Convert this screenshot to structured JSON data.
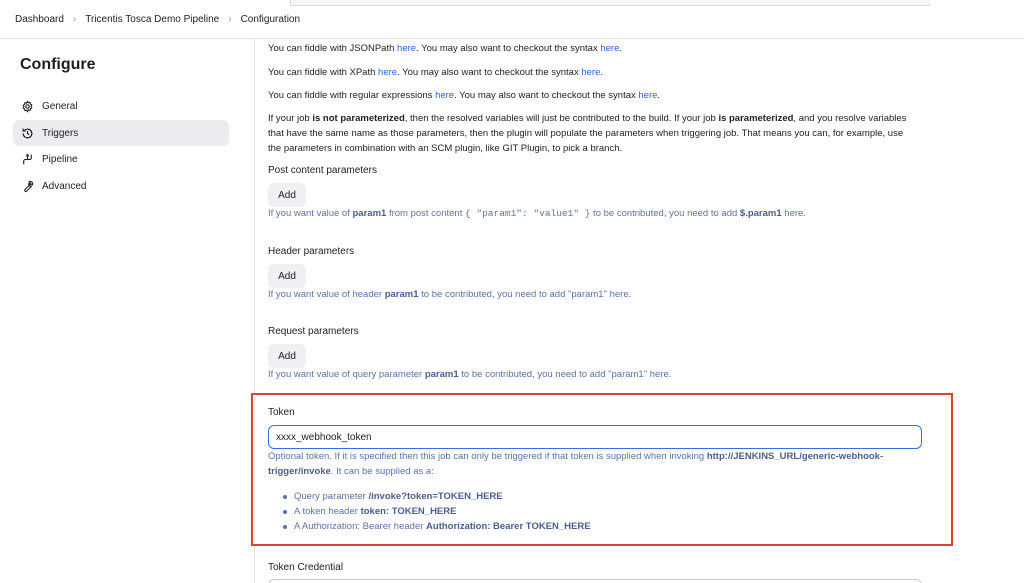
{
  "breadcrumb": [
    {
      "label": "Dashboard"
    },
    {
      "label": "Tricentis Tosca Demo Pipeline"
    },
    {
      "label": "Configuration"
    }
  ],
  "sidebar": {
    "title": "Configure",
    "items": [
      {
        "label": "General",
        "icon": "gear-icon",
        "active": false
      },
      {
        "label": "Triggers",
        "icon": "clock-icon",
        "active": true
      },
      {
        "label": "Pipeline",
        "icon": "pipeline-icon",
        "active": false
      },
      {
        "label": "Advanced",
        "icon": "wrench-icon",
        "active": false
      }
    ]
  },
  "main": {
    "jsonpath": {
      "pre": "You can fiddle with JSONPath ",
      "link1": "here",
      "mid": ". You may also want to checkout the syntax ",
      "link2": "here",
      "post": "."
    },
    "xpath": {
      "pre": "You can fiddle with XPath ",
      "link1": "here",
      "mid": ". You may also want to checkout the syntax ",
      "link2": "here",
      "post": "."
    },
    "regex": {
      "pre": "You can fiddle with regular expressions ",
      "link1": "here",
      "mid": ". You may also want to checkout the syntax ",
      "link2": "here",
      "post": "."
    },
    "param_note": {
      "t1": "If your job ",
      "b1": "is not parameterized",
      "t2": ", then the resolved variables will just be contributed to the build. If your job ",
      "b2": "is parameterized",
      "t3": ", and you resolve variables that have the same name as those parameters, then the plugin will populate the parameters when triggering job. That means you can, for example, use the parameters in combination with an SCM plugin, like GIT Plugin, to pick a branch."
    },
    "post_content": {
      "label": "Post content parameters",
      "button": "Add",
      "help": {
        "t1": "If you want value of ",
        "b1": "param1",
        "t2": " from post content ",
        "code": "{ \"param1\": \"value1\" }",
        "t3": " to be contributed, you need to add ",
        "b2": "$.param1",
        "t4": " here."
      }
    },
    "header_params": {
      "label": "Header parameters",
      "button": "Add",
      "help": {
        "t1": "If you want value of header ",
        "b1": "param1",
        "t2": " to be contributed, you need to add \"param1\" here."
      }
    },
    "request_params": {
      "label": "Request parameters",
      "button": "Add",
      "help": {
        "t1": "If you want value of query parameter ",
        "b1": "param1",
        "t2": " to be contributed, you need to add \"param1\" here."
      }
    },
    "token": {
      "label": "Token",
      "value": "xxxx_webhook_token",
      "help": {
        "t1": "Optional token. If it is specified then this job can only be triggered if that token is supplied when invoking ",
        "b1": "http://JENKINS_URL/generic-webhook-trigger/invoke",
        "t2": ". It can be supplied as a:"
      },
      "bullets": [
        {
          "text": "Query parameter ",
          "bold": "/invoke?token=TOKEN_HERE"
        },
        {
          "text": "A token header ",
          "bold": "token: TOKEN_HERE"
        },
        {
          "text": "A Authorization: Bearer header ",
          "bold": "Authorization: Bearer TOKEN_HERE"
        }
      ],
      "highlight_color": "#d9452c"
    },
    "token_credential": {
      "label": "Token Credential"
    }
  },
  "colors": {
    "link": "#2a63d4",
    "help_text": "#5b73a5",
    "active_bg": "#ebecf0",
    "focus_border": "#3b6fd8"
  }
}
